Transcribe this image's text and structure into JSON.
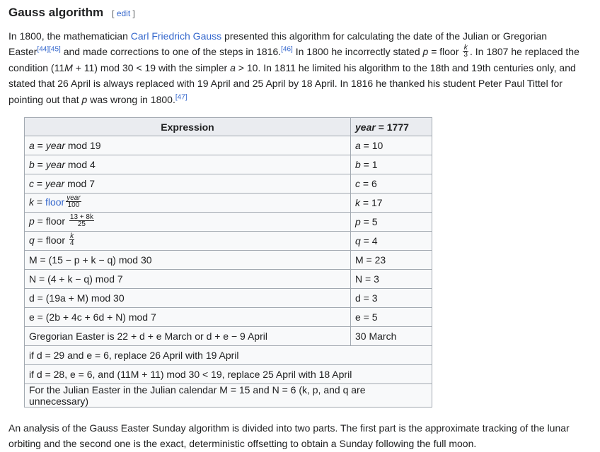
{
  "heading": {
    "title": "Gauss algorithm",
    "edit_open": "[",
    "edit_label": "edit",
    "edit_close": "]"
  },
  "intro": {
    "s1": "In 1800, the mathematician ",
    "gauss_link": "Carl Friedrich Gauss",
    "s2": " presented this algorithm for calculating the date of the Julian or Gregorian Easter",
    "ref44": "[44]",
    "ref45": "[45]",
    "s3": " and made corrections to one of the steps in 1816.",
    "ref46": "[46]",
    "s4": " In 1800 he incorrectly stated ",
    "s4_var": "p",
    "s4_eq": " = floor ",
    "frac_num": "k",
    "frac_den": "3",
    "s5": ". In 1807 he replaced the condition (11",
    "s5_var": "M",
    "s6": " + 11) mod 30 < 19 with the simpler ",
    "s6_var": "a",
    "s7": " > 10. In 1811 he limited his algorithm to the 18th and 19th centuries only, and stated that 26 April is always replaced with 19 April and 25 April by 18 April. In 1816 he thanked his student Peter Paul Tittel for pointing out that ",
    "s7_var": "p",
    "s8": " was wrong in 1800.",
    "ref47": "[47]"
  },
  "table": {
    "header_expression": "Expression",
    "header_year_var": "year",
    "header_year_eq": " = 1777",
    "rows": {
      "a": {
        "lhs": "a",
        "op": " = ",
        "var": "year",
        "rest": " mod 19",
        "val_var": "a",
        "val": " = 10"
      },
      "b": {
        "lhs": "b",
        "op": " = ",
        "var": "year",
        "rest": " mod 4",
        "val_var": "b",
        "val": " = 1"
      },
      "c": {
        "lhs": "c",
        "op": " = ",
        "var": "year",
        "rest": " mod 7",
        "val_var": "c",
        "val": " = 6"
      },
      "k": {
        "lhs": "k",
        "op": " = ",
        "link": "floor",
        "num": "year",
        "den": "100",
        "val_var": "k",
        "val": " = 17"
      },
      "p": {
        "lhs": "p",
        "op": " = floor ",
        "num": "13 + 8k",
        "den": "25",
        "val_var": "p",
        "val": " = 5"
      },
      "q": {
        "lhs": "q",
        "op": " = floor ",
        "num": "k",
        "den": "4",
        "val_var": "q",
        "val": " = 4"
      },
      "M": {
        "text": "M = (15 − p + k − q) mod 30",
        "val": "M = 23"
      },
      "N": {
        "text": "N = (4 + k − q) mod 7",
        "val": "N = 3"
      },
      "d": {
        "text": "d = (19a + M) mod 30",
        "val": "d = 3"
      },
      "e": {
        "text": "e = (2b + 4c + 6d + N) mod 7",
        "val": "e = 5"
      },
      "greg": {
        "text": "Gregorian Easter is 22 + d + e March or d + e − 9 April",
        "val": "30 March"
      },
      "r1": {
        "text": "if d = 29 and e = 6, replace 26 April with 19 April"
      },
      "r2": {
        "text": "if d = 28, e = 6, and (11M + 11) mod 30 < 19, replace 25 April with 18 April"
      },
      "r3": {
        "text": "For the Julian Easter in the Julian calendar M = 15 and N = 6 (k, p, and q are unnecessary)"
      }
    }
  },
  "after": {
    "text": "An analysis of the Gauss Easter Sunday algorithm is divided into two parts. The first part is the approximate tracking of the lunar orbiting and the second one is the exact, deterministic offsetting to obtain a Sunday following the full moon."
  }
}
